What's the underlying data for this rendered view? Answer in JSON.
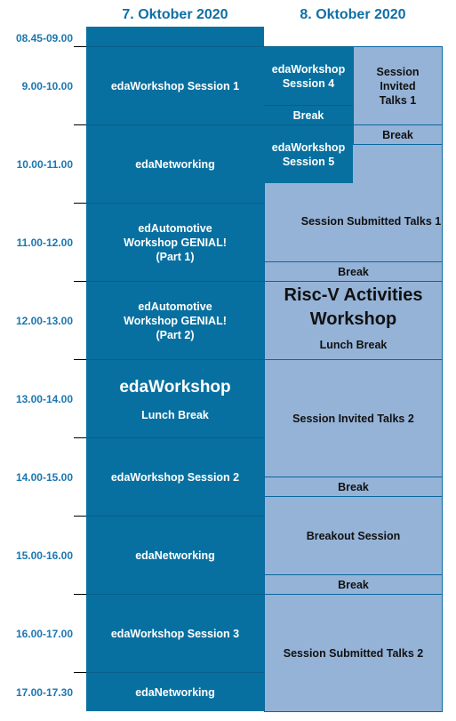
{
  "days": [
    "7. Oktober 2020",
    "8. Oktober 2020"
  ],
  "times": [
    "08.45-09.00",
    "9.00-10.00",
    "10.00-11.00",
    "11.00-12.00",
    "12.00-13.00",
    "13.00-14.00",
    "14.00-15.00",
    "15.00-16.00",
    "16.00-17.00",
    "17.00-17.30"
  ],
  "colors": {
    "dark": "#0870a0",
    "light": "#95b3d7",
    "time_text": "#1b77b1"
  },
  "day1": [
    {
      "label": ""
    },
    {
      "label": "edaWorkshop Session 1"
    },
    {
      "label": "edaNetworking"
    },
    {
      "label": "edAutomotive Workshop GENIAL! (Part 1)"
    },
    {
      "label": "edAutomotive Workshop GENIAL! (Part 2)"
    },
    {
      "title": "edaWorkshop",
      "label": "Lunch Break"
    },
    {
      "label": "edaWorkshop Session 2"
    },
    {
      "label": "edaNetworking"
    },
    {
      "label": "edaWorkshop Session 3"
    },
    {
      "label": "edaNetworking"
    }
  ],
  "day2": {
    "session4": "edaWorkshop Session 4",
    "break_a": "Break",
    "session5": "edaWorkshop Session 5",
    "invited1": "Session Invited Talks 1",
    "break_b": "Break",
    "submitted1": "Session Submitted Talks 1",
    "break_c": "Break",
    "riscv_title": "Risc-V Activities Workshop",
    "riscv_lunch": "Lunch Break",
    "invited2": "Session Invited Talks 2",
    "break_d": "Break",
    "breakout": "Breakout Session",
    "break_e": "Break",
    "submitted2": "Session Submitted Talks 2"
  }
}
